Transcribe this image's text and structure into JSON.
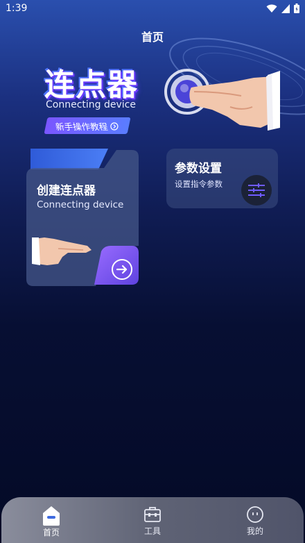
{
  "status": {
    "time": "1:39"
  },
  "page": {
    "title": "首页"
  },
  "hero": {
    "brand_title": "连点器",
    "brand_sub": "Connecting device",
    "tutorial_label": "新手操作教程"
  },
  "create_card": {
    "title": "创建连点器",
    "subtitle": "Connecting device"
  },
  "param_card": {
    "title": "参数设置",
    "subtitle": "设置指令参数"
  },
  "nav": {
    "home": "首页",
    "tools": "工具",
    "mine": "我的"
  },
  "icons": {
    "tutorial": "circle-arrow-icon",
    "create_action": "arrow-right-icon",
    "params": "sliders-icon",
    "home": "home-icon",
    "tools": "toolbox-icon",
    "mine": "face-icon"
  },
  "colors": {
    "accent": "#7a56ff",
    "accent2": "#5a7dff",
    "background_top": "#2a4fae",
    "background_bottom": "#040a26"
  }
}
